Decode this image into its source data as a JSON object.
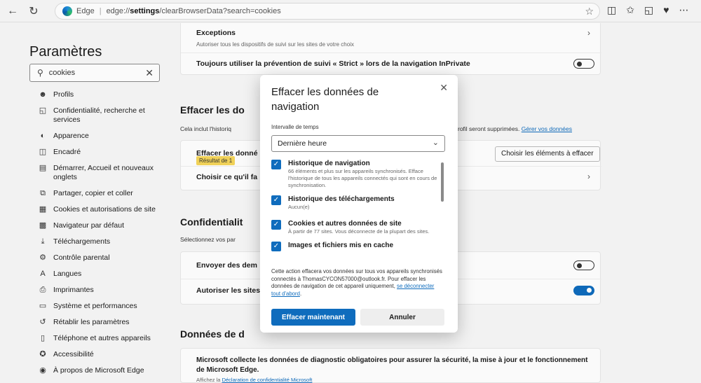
{
  "browser": {
    "tab_label": "Edge",
    "url_prefix": "edge://",
    "url_bold": "settings",
    "url_rest": "/clearBrowserData?search=cookies"
  },
  "sidebar": {
    "title": "Paramètres",
    "search_value": "cookies",
    "items": [
      {
        "icon": "profile-icon",
        "label": "Profils"
      },
      {
        "icon": "lock-icon",
        "label": "Confidentialité, recherche et services"
      },
      {
        "icon": "palette-icon",
        "label": "Apparence"
      },
      {
        "icon": "frame-icon",
        "label": "Encadré"
      },
      {
        "icon": "home-icon",
        "label": "Démarrer, Accueil et nouveaux onglets"
      },
      {
        "icon": "share-icon",
        "label": "Partager, copier et coller"
      },
      {
        "icon": "cookie-icon",
        "label": "Cookies et autorisations de site"
      },
      {
        "icon": "browser-icon",
        "label": "Navigateur par défaut"
      },
      {
        "icon": "download-icon",
        "label": "Téléchargements"
      },
      {
        "icon": "family-icon",
        "label": "Contrôle parental"
      },
      {
        "icon": "language-icon",
        "label": "Langues"
      },
      {
        "icon": "printer-icon",
        "label": "Imprimantes"
      },
      {
        "icon": "system-icon",
        "label": "Système et performances"
      },
      {
        "icon": "reset-icon",
        "label": "Rétablir les paramètres"
      },
      {
        "icon": "phone-icon",
        "label": "Téléphone et autres appareils"
      },
      {
        "icon": "accessibility-icon",
        "label": "Accessibilité"
      },
      {
        "icon": "edge-icon",
        "label": "À propos de Microsoft Edge"
      }
    ]
  },
  "main": {
    "exceptions_title": "Exceptions",
    "exceptions_desc": "Autoriser tous les dispositifs de suivi sur les sites de votre choix",
    "strict_label": "Toujours utiliser la prévention de suivi « Strict » lors de la navigation InPrivate",
    "clear_heading": "Effacer les do",
    "clear_desc": "Cela inclut l'historiq",
    "clear_desc_right": "rofil seront supprimées.",
    "manage_link": "Gérer vos données",
    "clear_now_label": "Effacer les donné",
    "tooltip": "Résultat de 1",
    "choose_btn": "Choisir les éléments à effacer",
    "choose_close_label": "Choisir ce qu'il fa",
    "privacy_heading": "Confidentialit",
    "privacy_desc": "Sélectionnez vos par",
    "send_label": "Envoyer des dem",
    "allow_label": "Autoriser les sites",
    "diag_heading": "Données de d",
    "diag_text": "Microsoft collecte les données de diagnostic obligatoires pour assurer la sécurité, la mise à jour et le fonctionnement de Microsoft Edge.",
    "diag_link_prefix": "Affichez la",
    "diag_link": "Déclaration de confidentialité Microsoft"
  },
  "dialog": {
    "title": "Effacer les données de navigation",
    "range_label": "Intervalle de temps",
    "range_value": "Dernière heure",
    "options": [
      {
        "title": "Historique de navigation",
        "desc": "66 éléments et plus sur les appareils synchronisés. Efface l'historique de tous les appareils connectés qui sont en cours de synchronisation.",
        "checked": true
      },
      {
        "title": "Historique des téléchargements",
        "desc": "Aucun(e)",
        "checked": true
      },
      {
        "title": "Cookies et autres données de site",
        "desc": "À partir de 77 sites. Vous déconnecte de la plupart des sites.",
        "checked": true
      },
      {
        "title": "Images et fichiers mis en cache",
        "desc": "",
        "checked": true
      }
    ],
    "note": "Cette action effacera vos données sur tous vos appareils synchronisés connectés à ThomasCYCON57000@outlook.fr. Pour effacer les données de navigation de cet appareil uniquement,",
    "note_link": "se déconnecter tout d'abord",
    "primary_btn": "Effacer maintenant",
    "cancel_btn": "Annuler"
  }
}
